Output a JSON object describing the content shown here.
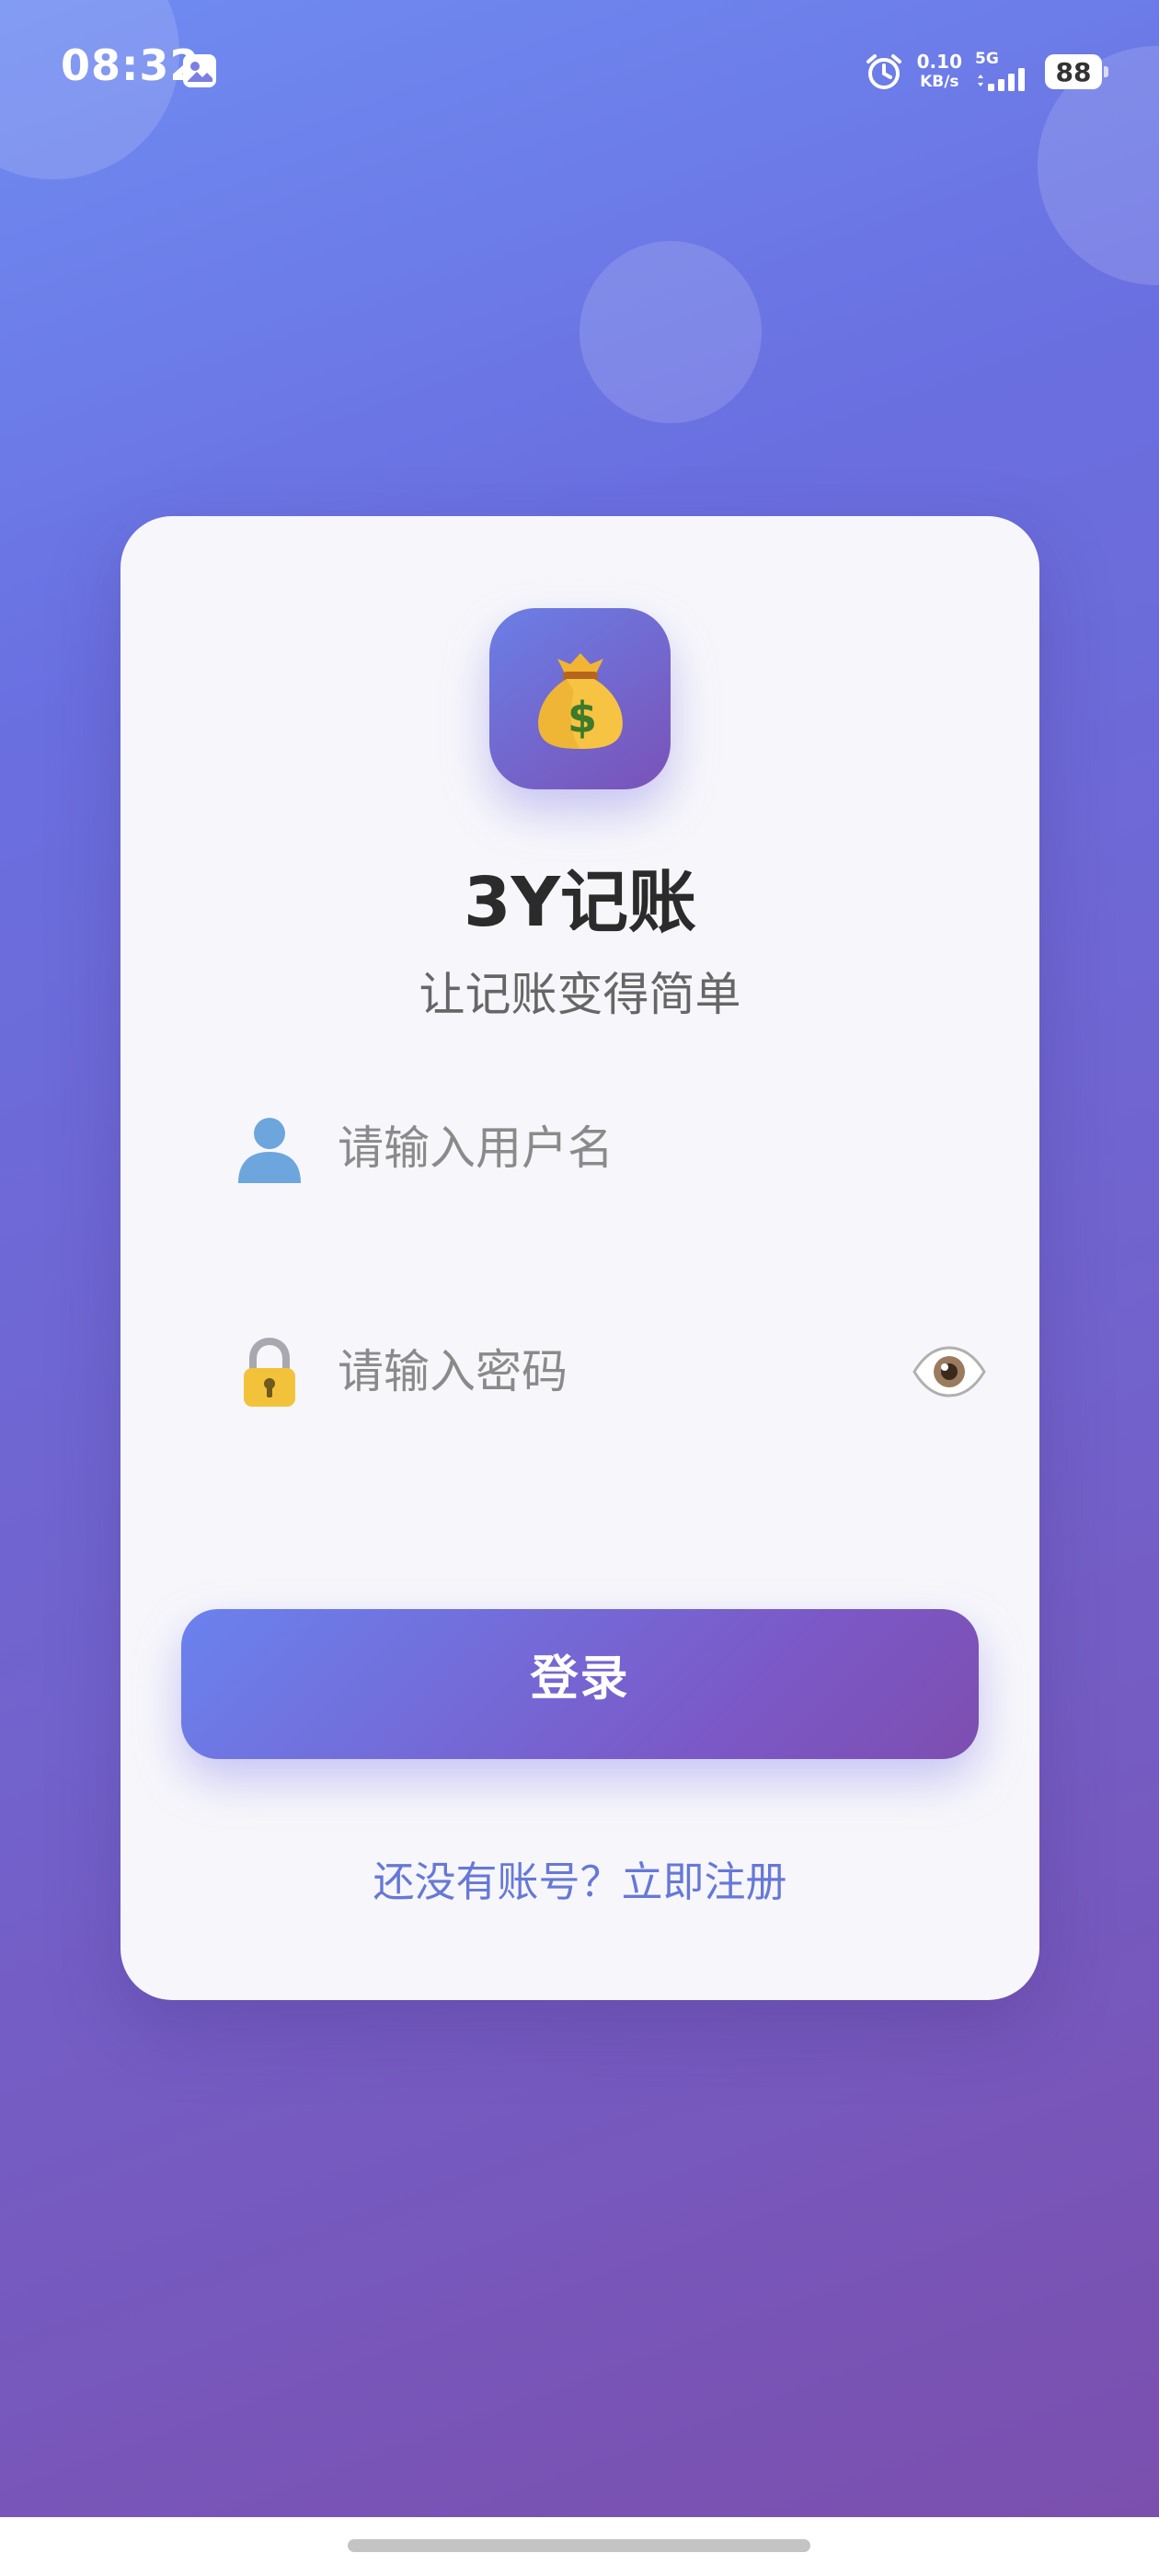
{
  "status_bar": {
    "time": "08:32",
    "net_speed_value": "0.10",
    "net_speed_unit": "KB/s",
    "signal_label": "5G",
    "battery": "88"
  },
  "login": {
    "app_icon": "money-bag-icon",
    "title": "3Y记账",
    "subtitle": "让记账变得简单",
    "username": {
      "icon": "user-icon",
      "placeholder": "请输入用户名",
      "value": ""
    },
    "password": {
      "icon": "lock-icon",
      "placeholder": "请输入密码",
      "value": "",
      "toggle_icon": "eye-icon"
    },
    "login_button_label": "登录",
    "register_link": "还没有账号？立即注册"
  },
  "colors": {
    "gradient_start": "#6f8cf2",
    "gradient_end": "#7b4fae",
    "card_background": "#f7f7fb",
    "title_color": "#2b2b2b",
    "link_color": "#6678d8",
    "button_gradient_start": "#6a82ee",
    "button_gradient_end": "#7e4eb0"
  }
}
